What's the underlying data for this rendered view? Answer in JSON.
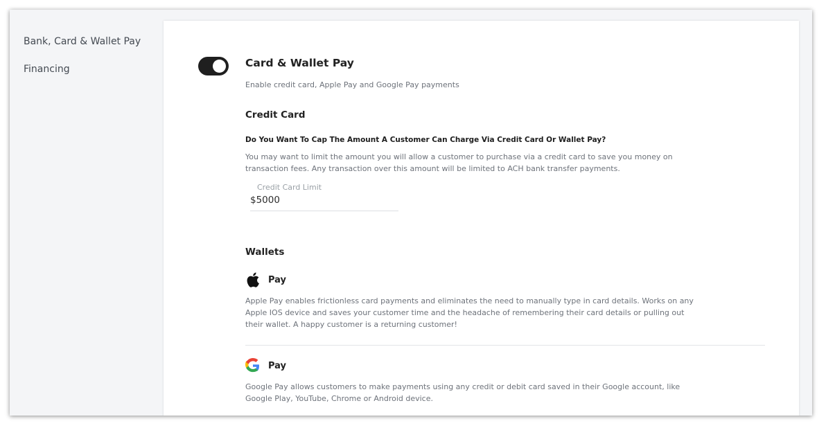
{
  "sidebar": {
    "items": [
      {
        "label": "Bank, Card & Wallet Pay"
      },
      {
        "label": "Financing"
      }
    ]
  },
  "card_wallet": {
    "title": "Card & Wallet Pay",
    "subtitle": "Enable credit card, Apple Pay and Google Pay payments",
    "enabled": true
  },
  "credit_card": {
    "heading": "Credit Card",
    "question": "Do You Want To Cap The Amount A Customer Can Charge Via Credit Card Or Wallet Pay?",
    "description": "You may want to limit the amount you will allow a customer to purchase via a credit card to save you money on transaction fees. Any transaction over this amount will be limited to ACH bank transfer payments.",
    "limit_label": "Credit Card Limit",
    "limit_value": "$5000"
  },
  "wallets": {
    "heading": "Wallets",
    "apple": {
      "icon": "apple-logo-icon",
      "label": "Pay",
      "description": "Apple Pay enables frictionless card payments and eliminates the need to manually type in card details. Works on any Apple IOS device and saves your customer time and the headache of remembering their card details or pulling out their wallet. A happy customer is a returning customer!"
    },
    "google": {
      "icon": "google-logo-icon",
      "label": "Pay",
      "description": "Google Pay allows customers to make payments using any credit or debit card saved in their Google account, like Google Play, YouTube, Chrome or Android device."
    }
  },
  "colors": {
    "toggle_on": "#1f1f1f",
    "text_primary": "#222222",
    "text_muted": "#6d727a",
    "sidebar_bg": "#f4f5f7"
  }
}
